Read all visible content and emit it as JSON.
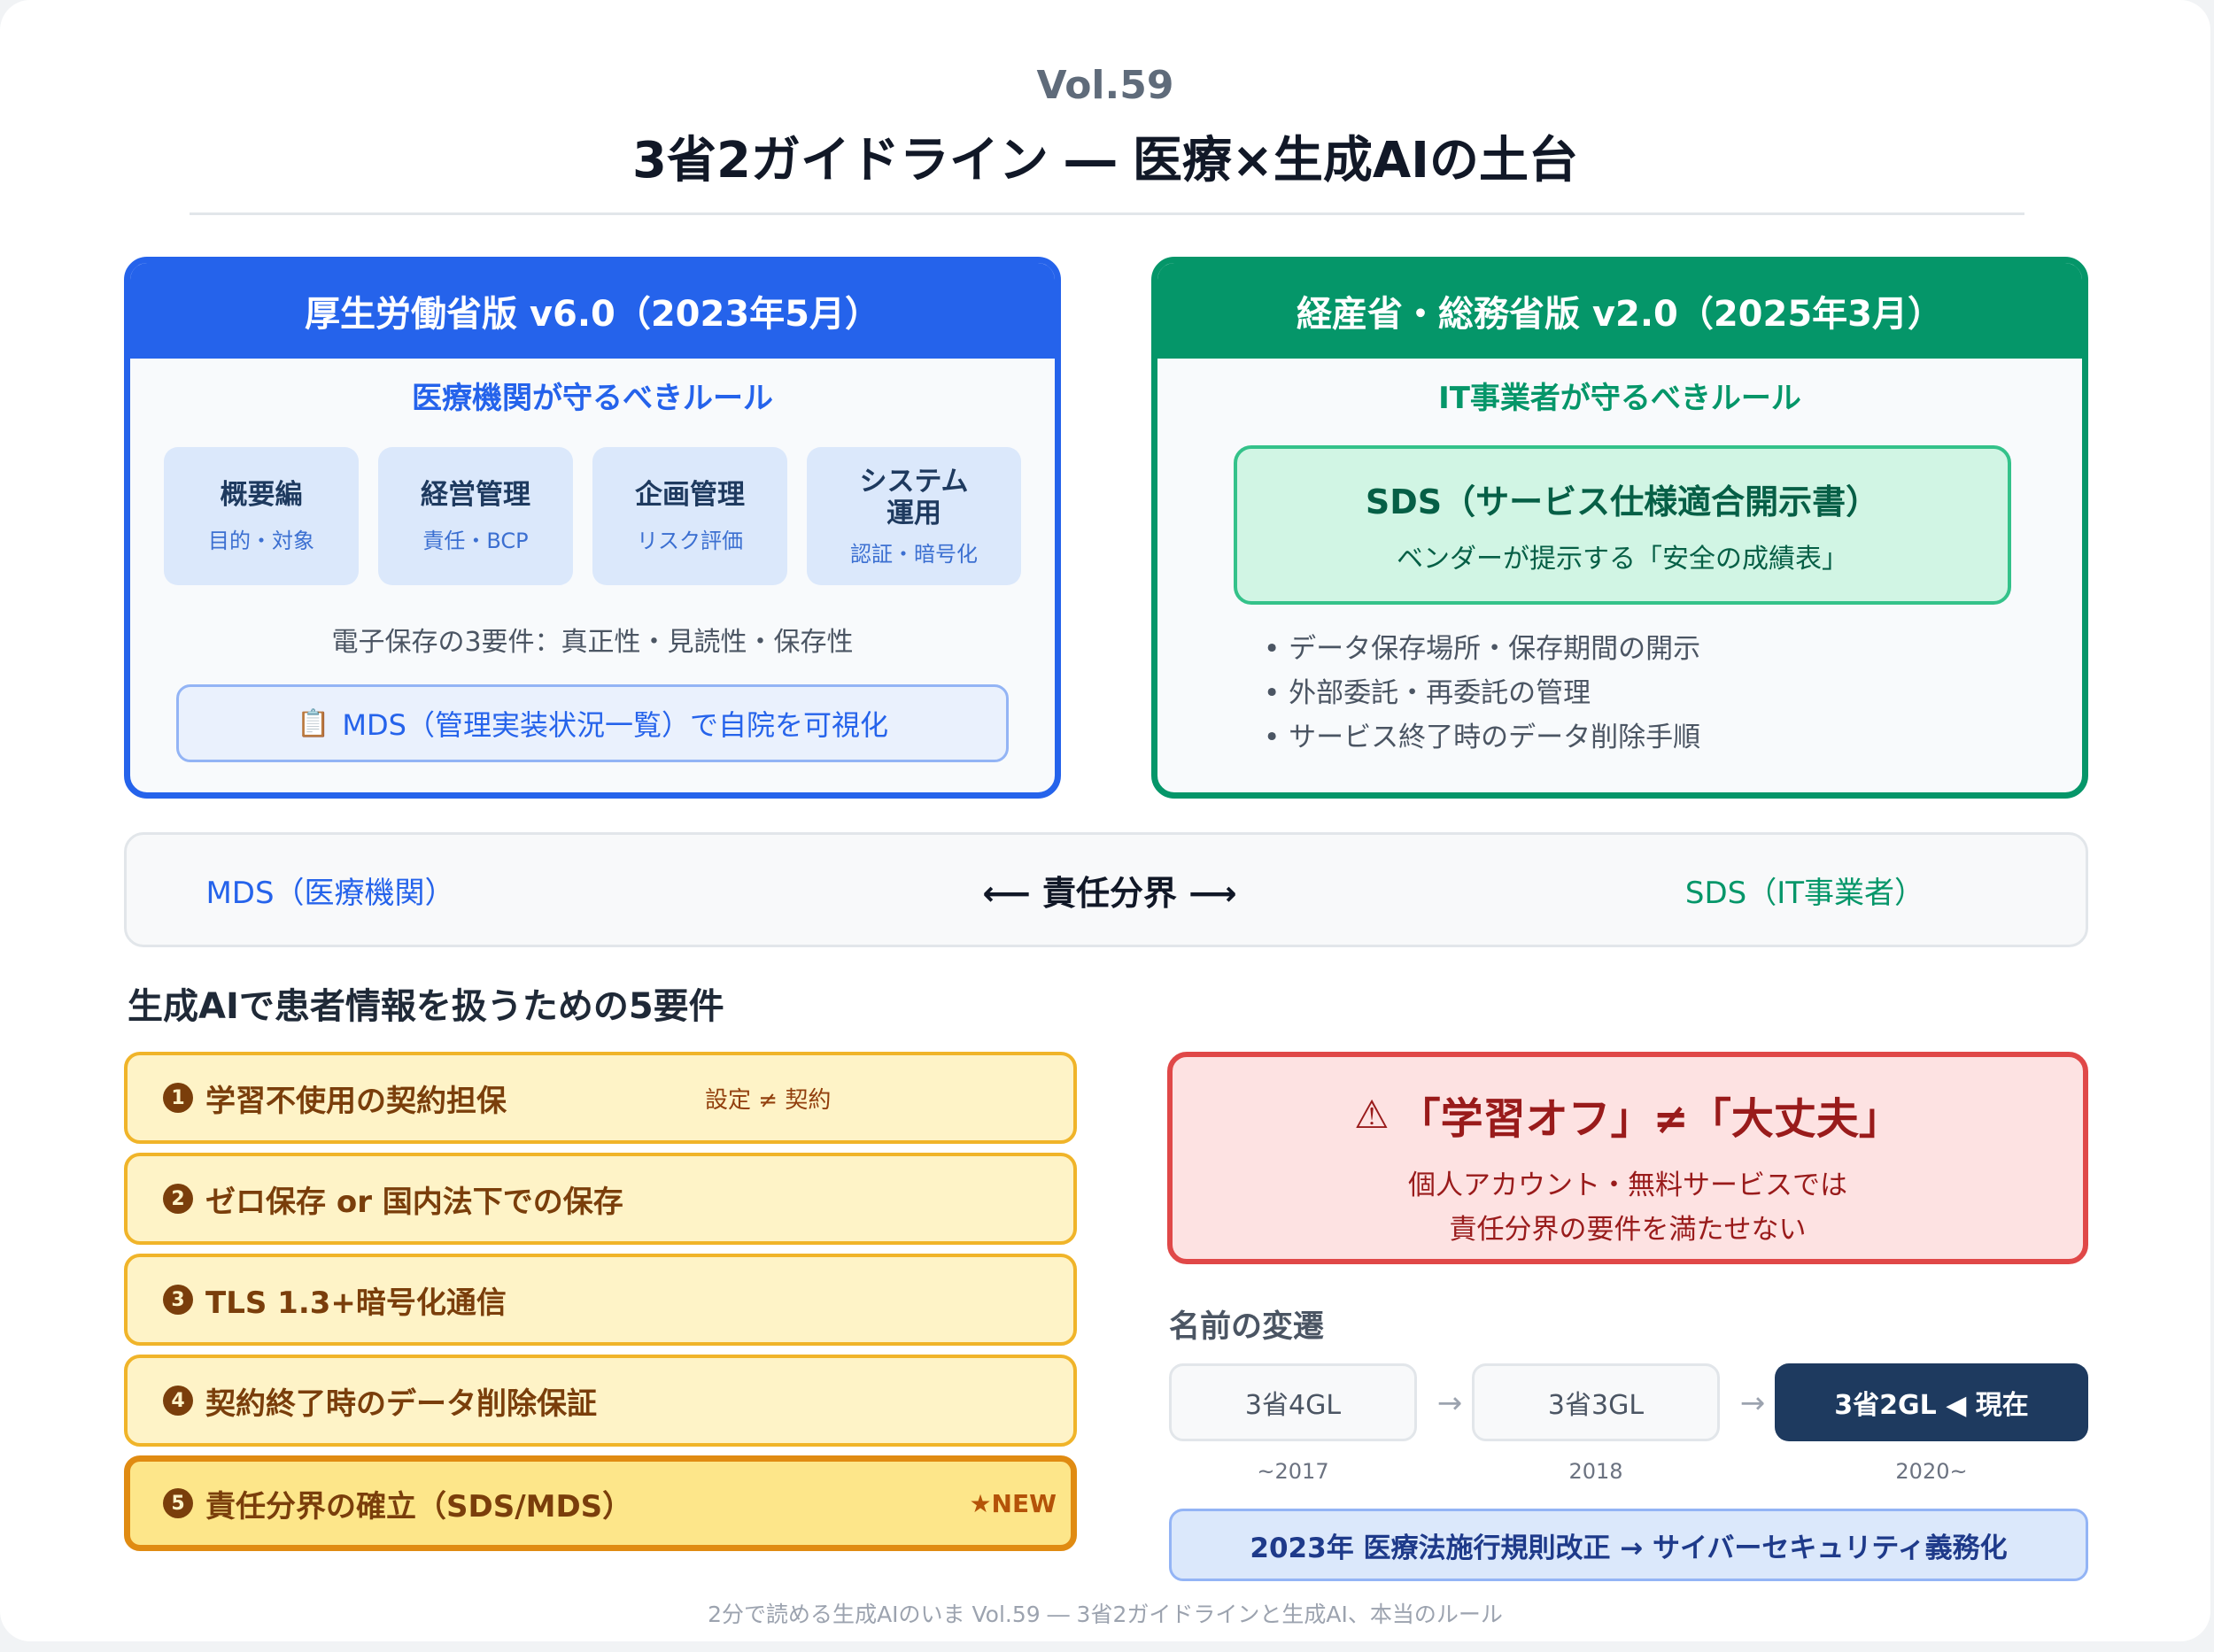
{
  "header": {
    "vol": "Vol.59",
    "title": "3省2ガイドライン ― 医療×生成AIの土台"
  },
  "mhlw_panel": {
    "title": "厚生労働省版 v6.0（2023年5月）",
    "subtitle": "医療機関が守るべきルール",
    "tiles": [
      {
        "name": "概要編",
        "note": "目的・対象"
      },
      {
        "name": "経営管理",
        "note": "責任・BCP"
      },
      {
        "name": "企画管理",
        "note": "リスク評価"
      },
      {
        "name_line1": "システム",
        "name_line2": "運用",
        "note": "認証・暗号化"
      }
    ],
    "requirements_text": "電子保存の3要件：真正性・見読性・保存性",
    "mds_icon": "clipboard-icon",
    "mds_glyph": "📋",
    "mds_text": "MDS（管理実装状況一覧）で自院を可視化"
  },
  "meti_panel": {
    "title": "経産省・総務省版 v2.0（2025年3月）",
    "subtitle": "IT事業者が守るべきルール",
    "sds_title": "SDS（サービス仕様適合開示書）",
    "sds_desc": "ベンダーが提示する「安全の成績表」",
    "bullets": [
      "• データ保存場所・保存期間の開示",
      "• 外部委託・再委託の管理",
      "• サービス終了時のデータ削除手順"
    ]
  },
  "responsibility": {
    "left": "MDS（医療機関）",
    "center": "⟵ 責任分界 ⟶",
    "right": "SDS（IT事業者）"
  },
  "requirements_section": {
    "heading": "生成AIで患者情報を扱うための5要件",
    "items": [
      {
        "num": "1",
        "text": "学習不使用の契約担保",
        "note": "設定 ≠ 契約"
      },
      {
        "num": "2",
        "text": "ゼロ保存 or 国内法下での保存"
      },
      {
        "num": "3",
        "text": "TLS 1.3+暗号化通信"
      },
      {
        "num": "4",
        "text": "契約終了時のデータ削除保証"
      },
      {
        "num": "5",
        "text": "責任分界の確立（SDS/MDS）",
        "badge": "★NEW"
      }
    ]
  },
  "warning": {
    "icon": "warning-icon",
    "glyph": "⚠",
    "title": "「学習オフ」≠「大丈夫」",
    "line1": "個人アカウント・無料サービスでは",
    "line2": "責任分界の要件を満たせない"
  },
  "history": {
    "heading": "名前の変遷",
    "arrow": "→",
    "steps": [
      {
        "label": "3省4GL",
        "year": "~2017"
      },
      {
        "label": "3省3GL",
        "year": "2018"
      },
      {
        "label": "3省2GL ◀ 現在",
        "year": "2020~"
      }
    ],
    "law_note": "2023年 医療法施行規則改正 → サイバーセキュリティ義務化"
  },
  "footer": "2分で読める生成AIのいま Vol.59 ― 3省2ガイドラインと生成AI、本当のルール",
  "colors": {
    "mhlw_blue": "#2563eb",
    "meti_green": "#059669",
    "requirement_amber": "#f0b429",
    "warning_red": "#e04848",
    "current_navy": "#1e3a5f"
  }
}
